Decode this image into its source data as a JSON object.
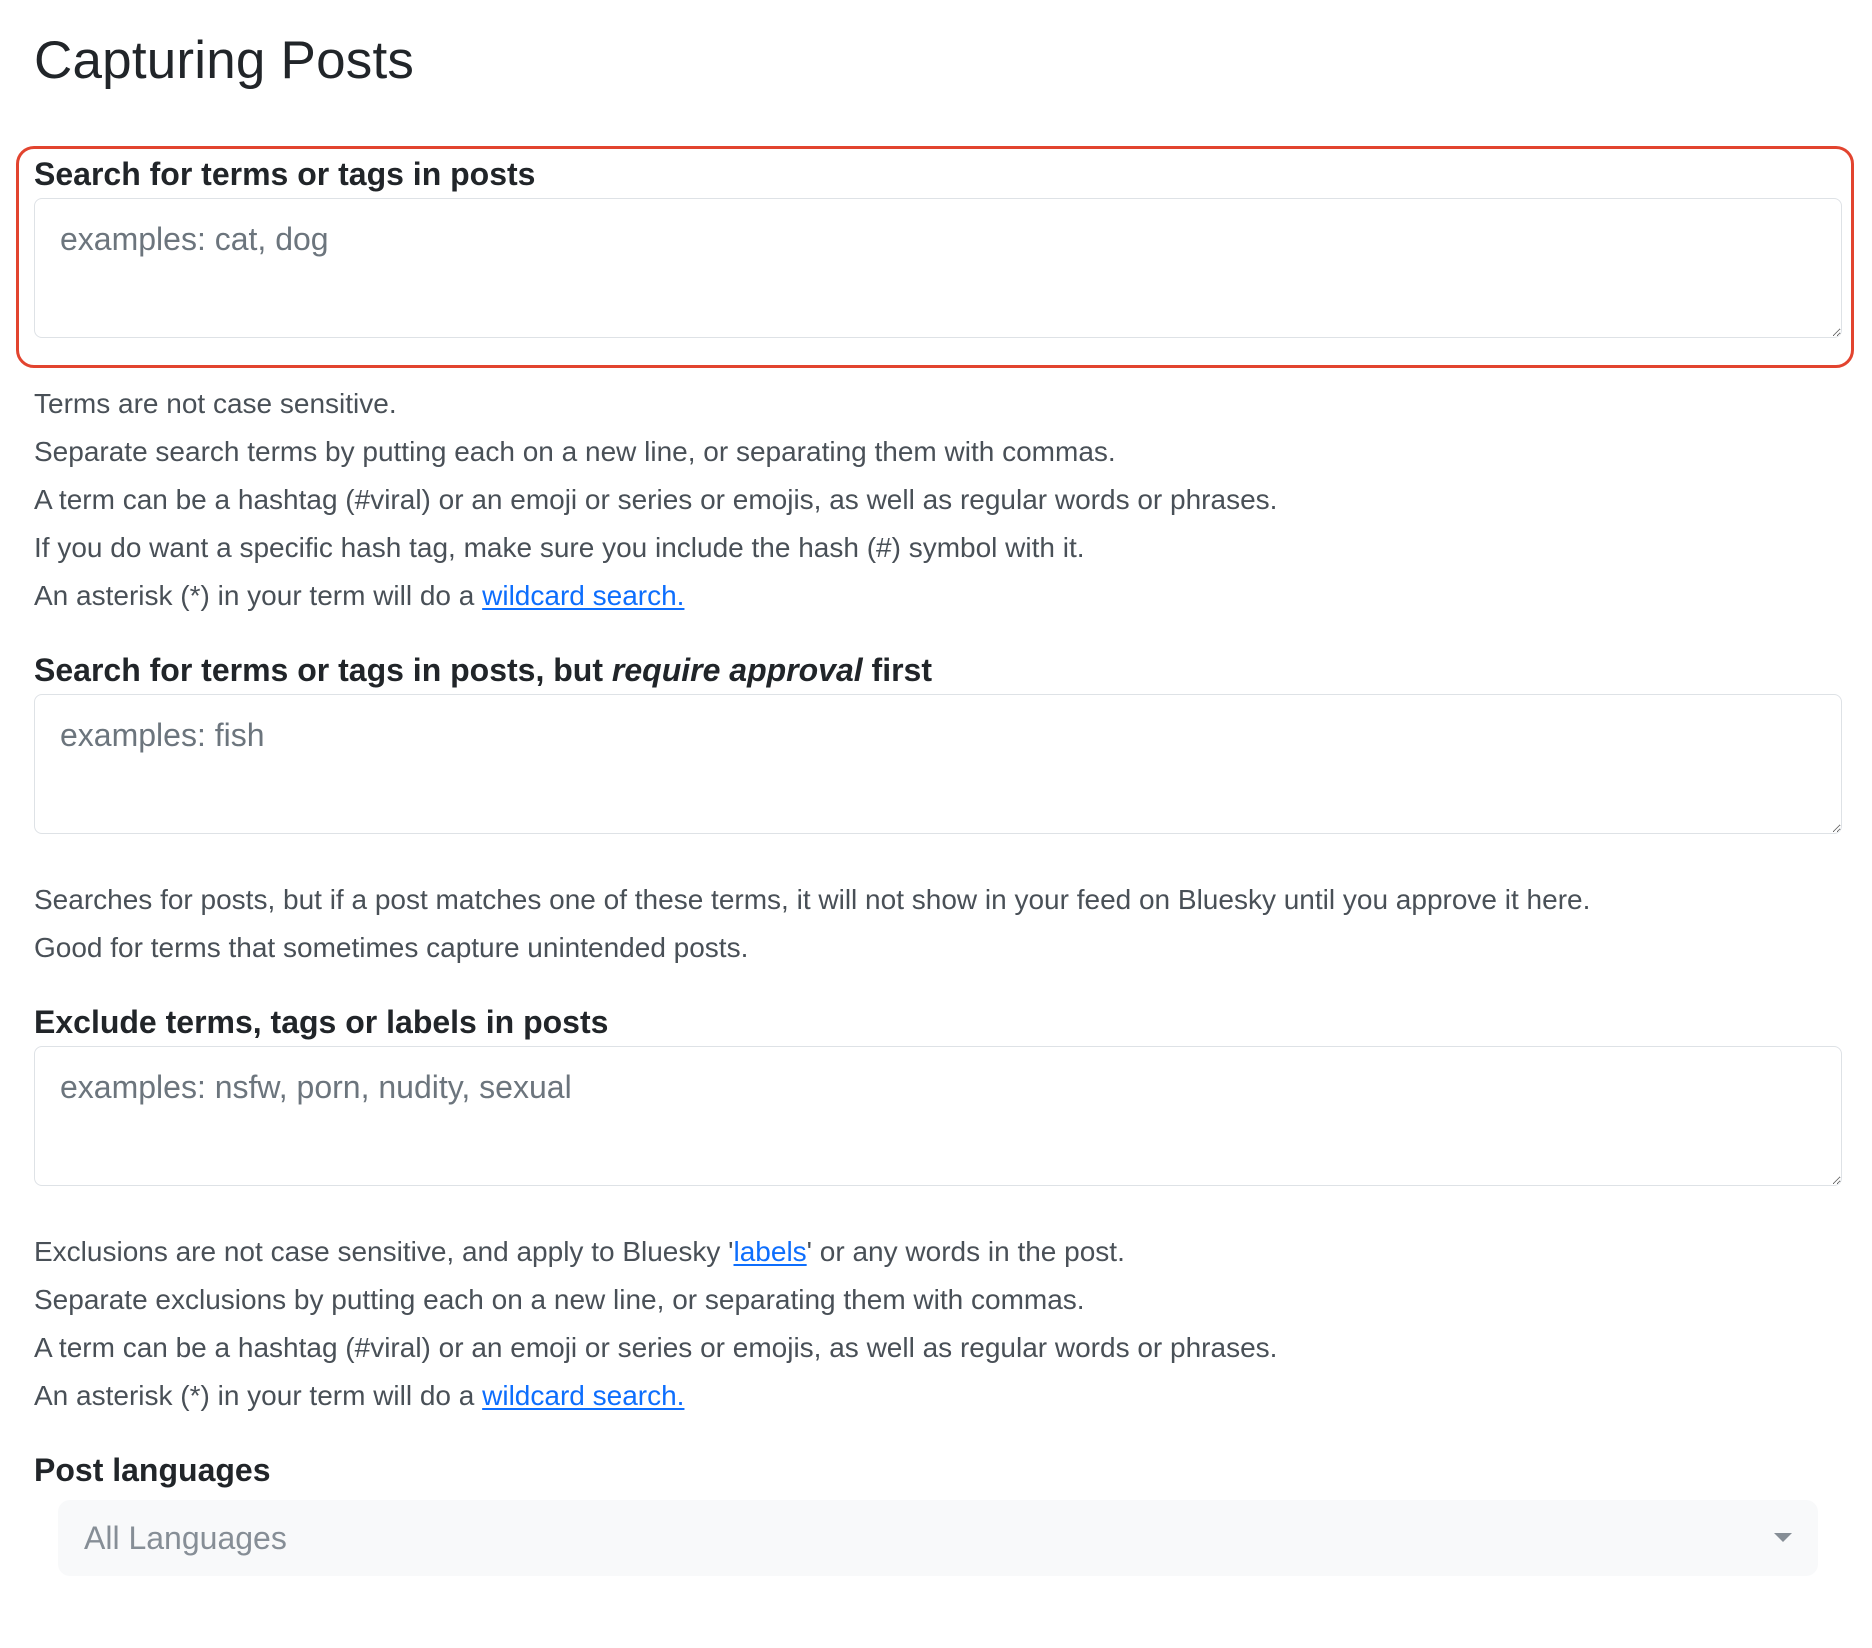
{
  "page": {
    "title": "Capturing Posts"
  },
  "search": {
    "label": "Search for terms or tags in posts",
    "placeholder": "examples: cat, dog",
    "help": [
      "Terms are not case sensitive.",
      "Separate search terms by putting each on a new line, or separating them with commas.",
      "A term can be a hashtag (#viral) or an emoji or series or emojis, as well as regular words or phrases.",
      "If you do want a specific hash tag, make sure you include the hash (#) symbol with it."
    ],
    "wildcard_prefix": "An asterisk (*) in your term will do a ",
    "wildcard_link": "wildcard search."
  },
  "approval": {
    "label_prefix": "Search for terms or tags in posts, but ",
    "label_emphasis": "require approval",
    "label_suffix": " first",
    "placeholder": "examples: fish",
    "help": [
      "Searches for posts, but if a post matches one of these terms, it will not show in your feed on Bluesky until you approve it here.",
      "Good for terms that sometimes capture unintended posts."
    ]
  },
  "exclude": {
    "label": "Exclude terms, tags or labels in posts",
    "placeholder": "examples: nsfw, porn, nudity, sexual",
    "help_line1_prefix": "Exclusions are not case sensitive, and apply to Bluesky '",
    "labels_link": "labels",
    "help_line1_suffix": "' or any words in the post.",
    "help": [
      "Separate exclusions by putting each on a new line, or separating them with commas.",
      "A term can be a hashtag (#viral) or an emoji or series or emojis, as well as regular words or phrases."
    ],
    "wildcard_prefix": "An asterisk (*) in your term will do a ",
    "wildcard_link": "wildcard search."
  },
  "languages": {
    "label": "Post languages",
    "selected": "All Languages"
  },
  "colors": {
    "highlight": "#e2442f",
    "link": "#0d6efd"
  }
}
